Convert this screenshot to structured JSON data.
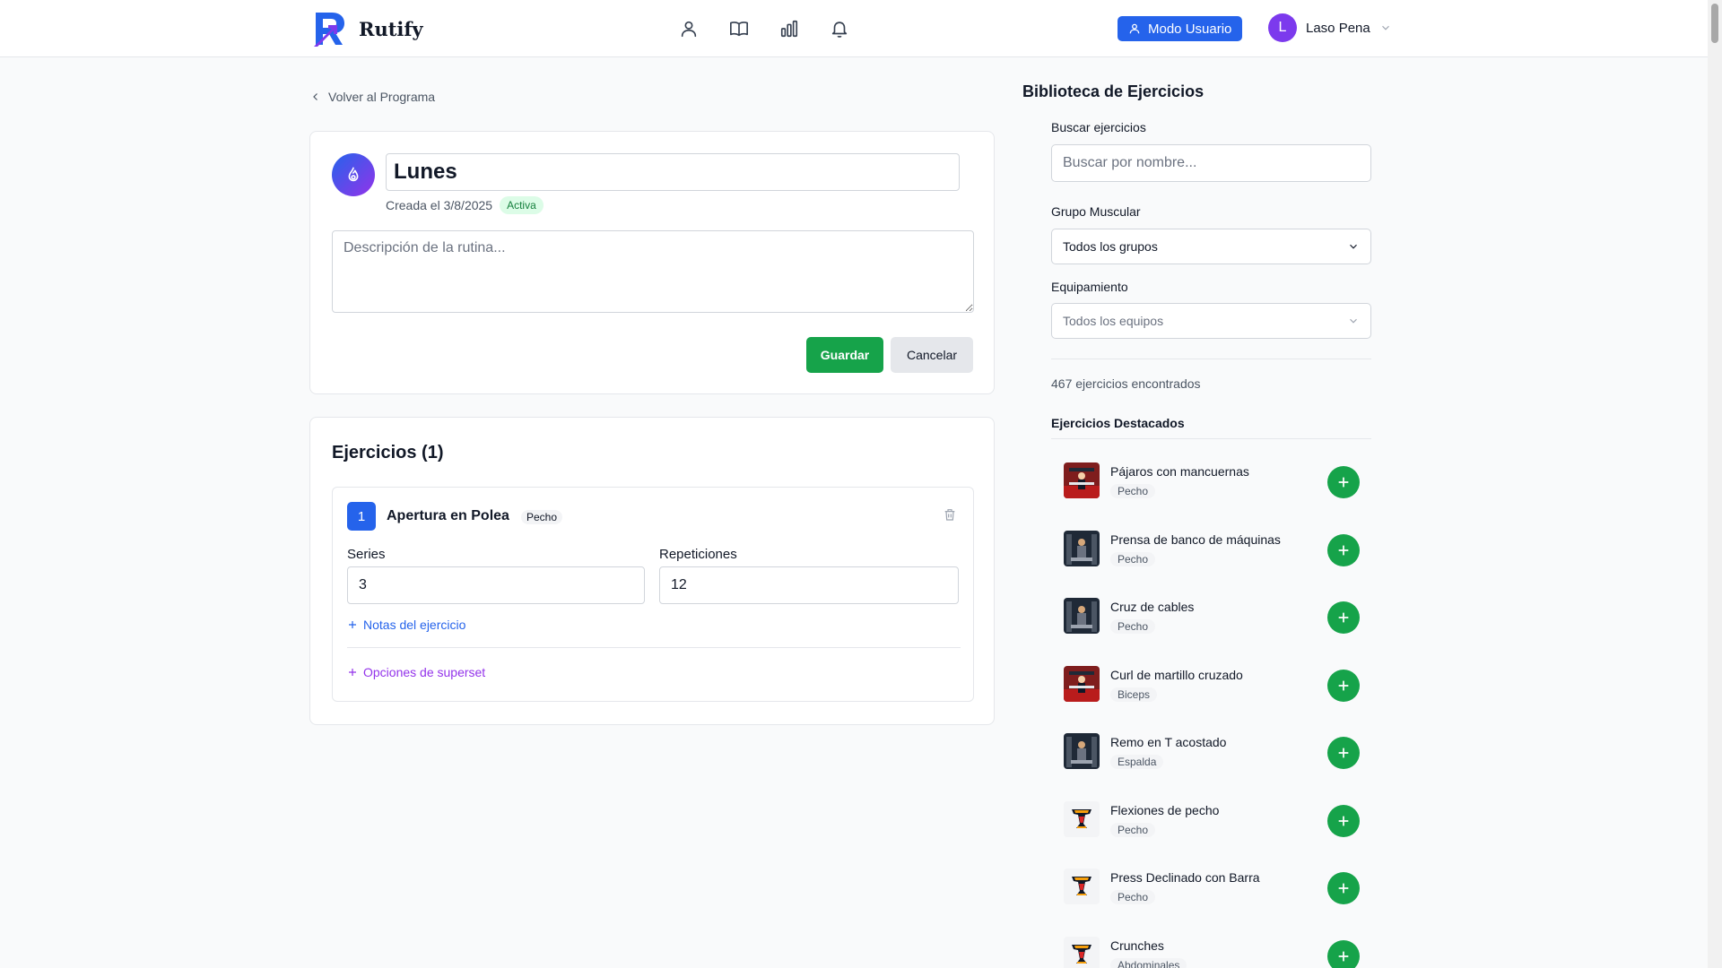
{
  "app": {
    "name": "Rutify",
    "mode_button": "Modo Usuario",
    "user": {
      "initial": "L",
      "name": "Laso Pena"
    },
    "nav_icons": [
      "user-icon",
      "book-icon",
      "bar-chart-icon",
      "bell-icon"
    ]
  },
  "back_link": "Volver al Programa",
  "routine": {
    "title": "Lunes",
    "created": "Creada el 3/8/2025",
    "status": "Activa",
    "description_placeholder": "Descripción de la rutina...",
    "save_label": "Guardar",
    "cancel_label": "Cancelar"
  },
  "exercises": {
    "heading": "Ejercicios (1)",
    "items": [
      {
        "number": "1",
        "name": "Apertura en Polea",
        "tag": "Pecho",
        "series_label": "Series",
        "series_value": "3",
        "reps_label": "Repeticiones",
        "reps_value": "12",
        "notes_link": "Notas del ejercicio",
        "superset_link": "Opciones de superset"
      }
    ]
  },
  "library": {
    "title": "Biblioteca de Ejercicios",
    "search_label": "Buscar ejercicios",
    "search_placeholder": "Buscar por nombre...",
    "muscle_label": "Grupo Muscular",
    "muscle_value": "Todos los grupos",
    "equipment_label": "Equipamiento",
    "equipment_value": "Todos los equipos",
    "count": "467 ejercicios encontrados",
    "featured_title": "Ejercicios Destacados",
    "featured": [
      {
        "name": "Pájaros con mancuernas",
        "group": "Pecho",
        "thumb": "photo-red"
      },
      {
        "name": "Prensa de banco de máquinas",
        "group": "Pecho",
        "thumb": "photo-dark"
      },
      {
        "name": "Cruz de cables",
        "group": "Pecho",
        "thumb": "photo-dark"
      },
      {
        "name": "Curl de martillo cruzado",
        "group": "Biceps",
        "thumb": "photo-red"
      },
      {
        "name": "Remo en T acostado",
        "group": "Espalda",
        "thumb": "photo-dark"
      },
      {
        "name": "Flexiones de pecho",
        "group": "Pecho",
        "thumb": "dumbbell-logo"
      },
      {
        "name": "Press Declinado con Barra",
        "group": "Pecho",
        "thumb": "dumbbell-logo"
      },
      {
        "name": "Crunches",
        "group": "Abdominales",
        "thumb": "dumbbell-logo"
      }
    ]
  },
  "colors": {
    "primary": "#2563eb",
    "success": "#16a34a",
    "purple": "#9333ea",
    "avatar": "#7c3aed"
  }
}
